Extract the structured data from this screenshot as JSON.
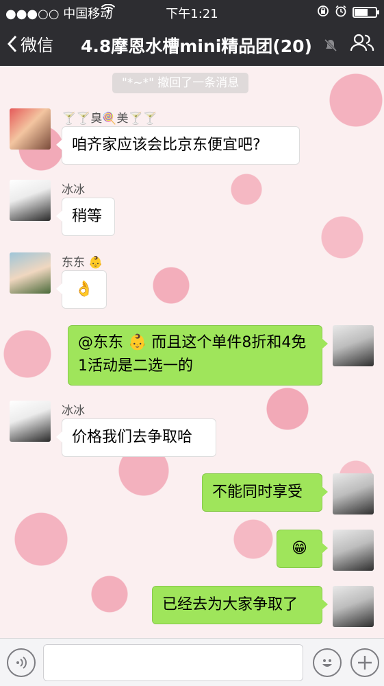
{
  "status_bar": {
    "carrier": "●●●○○ 中国移动",
    "time": "下午1:21"
  },
  "nav": {
    "back_label": "微信",
    "title": "4.8摩恩水槽mini精品团(20)"
  },
  "system_message": "\"*~*\" 撤回了一条消息",
  "messages": [
    {
      "sender": "🍸🍸臭🍭美🍸🍸",
      "text": "咱齐家应该会比京东便宜吧?"
    },
    {
      "sender": "冰冰",
      "text": "稍等"
    },
    {
      "sender": "东东 👶",
      "text": "👌"
    },
    {
      "text": "@东东 👶 而且这个单件8折和4免1活动是二选一的"
    },
    {
      "sender": "冰冰",
      "text": "价格我们去争取哈"
    },
    {
      "text": "不能同时享受"
    },
    {
      "text": "😁"
    },
    {
      "text": "已经去为大家争取了"
    }
  ],
  "icons": {
    "status": [
      "wifi-icon",
      "rotation-lock-icon",
      "alarm-icon",
      "battery-icon"
    ],
    "nav": [
      "back-chevron-icon",
      "mute-icon",
      "group-members-icon"
    ],
    "input": [
      "voice-icon",
      "emoji-icon",
      "plus-icon"
    ]
  },
  "colors": {
    "nav_bg": "#2d2d31",
    "out_bubble": "#9fe55b",
    "in_bubble": "#ffffff"
  }
}
